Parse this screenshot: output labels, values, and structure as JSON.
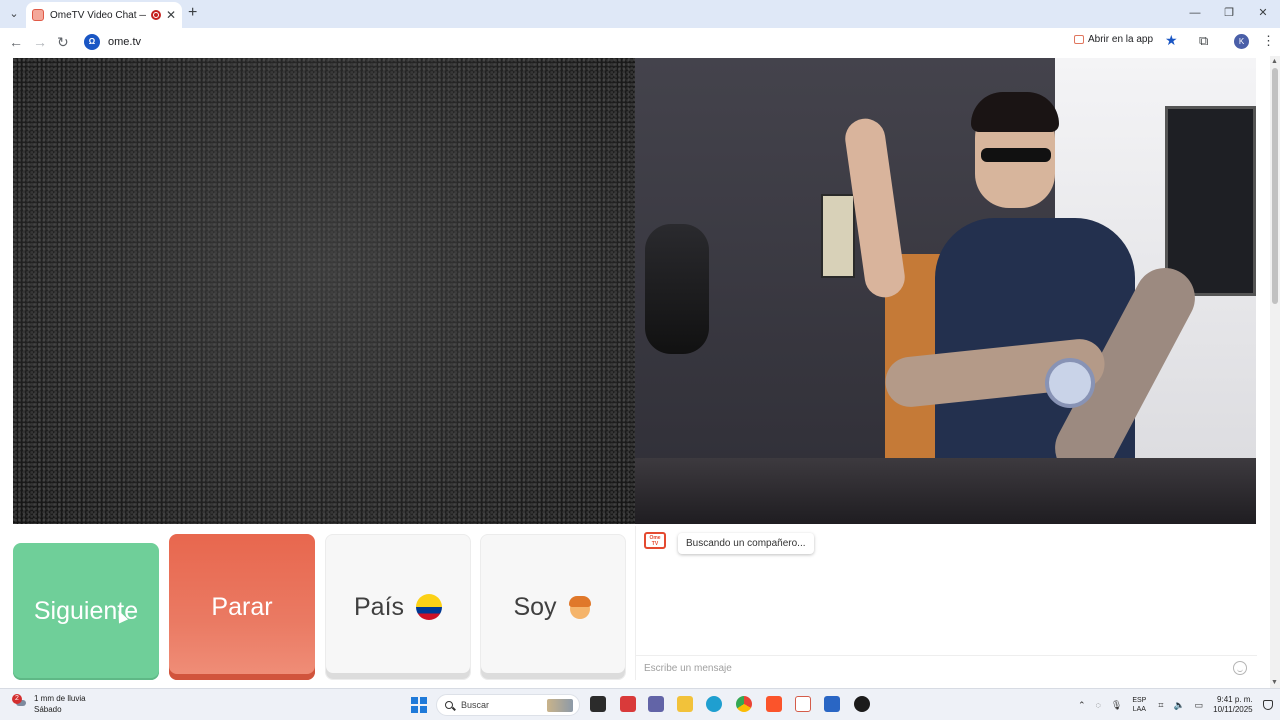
{
  "browser": {
    "tab_title": "OmeTV Video Chat — Ome",
    "tab_list_icon": "chevron-down-icon",
    "new_tab": "+",
    "close_tab": "✕",
    "window_controls": [
      "—",
      "❐",
      "✕"
    ],
    "url": "ome.tv",
    "open_in_app": "Abrir en la app",
    "profile_initial": "K"
  },
  "controls": {
    "next_label": "Siguiente",
    "stop_label": "Parar",
    "country_label": "País",
    "country_flag": "colombia-flag-icon",
    "gender_label": "Soy",
    "gender_icon": "boy-icon"
  },
  "chat": {
    "logo_text": "Ome TV",
    "messages": [
      {
        "sender": "system",
        "text": "Buscando un compañero..."
      }
    ],
    "input_placeholder": "Escribe un mensaje"
  },
  "taskbar": {
    "weather_badge": "2",
    "weather_line1": "1 mm de lluvia",
    "weather_line2": "Sábado",
    "search_placeholder": "Buscar",
    "lang_line1": "ESP",
    "lang_line2": "LAA",
    "time": "9:41 p. m.",
    "date": "10/11/2025"
  },
  "colors": {
    "next": "#6fcf99",
    "stop": "#e8674e",
    "neutral_button": "#f7f7f7",
    "accent_blue": "#1a56c4"
  }
}
